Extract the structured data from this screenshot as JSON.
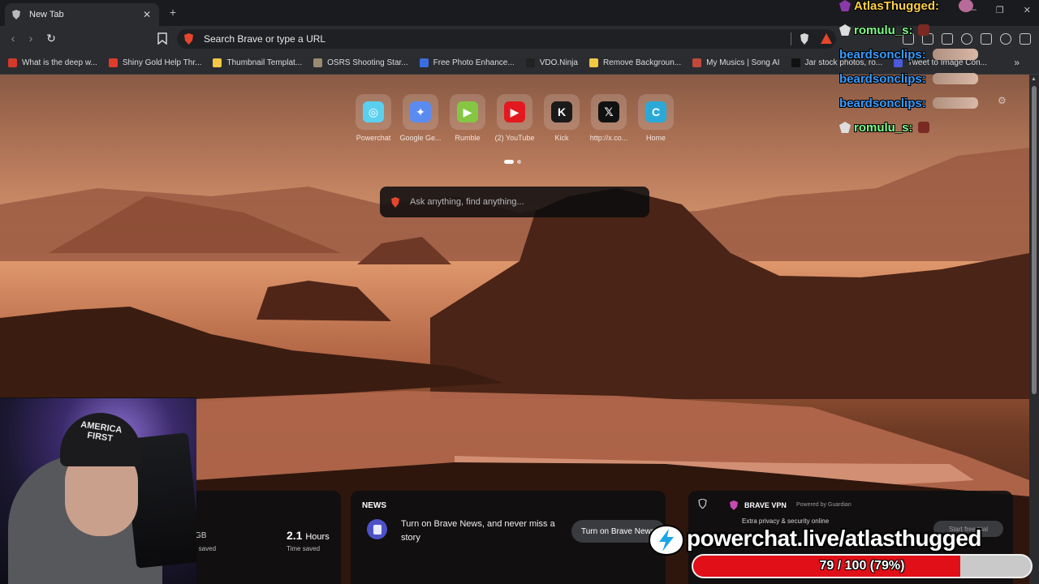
{
  "tab": {
    "title": "New Tab",
    "close": "✕",
    "new_tab": "+"
  },
  "window": {
    "minimize": "—",
    "maximize": "❐",
    "close": "✕"
  },
  "toolbar": {
    "back": "‹",
    "forward": "›",
    "reload": "↻",
    "omnibox_placeholder": "Search Brave or type a URL"
  },
  "bookmarks": [
    {
      "label": "What is the deep w...",
      "color": "#d23a2a"
    },
    {
      "label": "Shiny Gold Help Thr...",
      "color": "#e03c2c"
    },
    {
      "label": "Thumbnail Templat...",
      "color": "#f2c744"
    },
    {
      "label": "OSRS Shooting Star...",
      "color": "#9a8a70"
    },
    {
      "label": "Free Photo Enhance...",
      "color": "#3a6ee0"
    },
    {
      "label": "VDO.Ninja",
      "color": "#222222"
    },
    {
      "label": "Remove Backgroun...",
      "color": "#f2c744"
    },
    {
      "label": "My Musics | Song AI",
      "color": "#c04a3a"
    },
    {
      "label": "Jar stock photos, ro...",
      "color": "#111111"
    },
    {
      "label": "Tweet to Image Con...",
      "color": "#4a5ad8"
    }
  ],
  "bookmarks_more": "»",
  "top_sites": [
    {
      "label": "Powerchat",
      "icon": "powerchat-icon",
      "glyph": "◎",
      "bg": "#5ad0f0"
    },
    {
      "label": "Google Ge...",
      "icon": "gemini-icon",
      "glyph": "✦",
      "bg": "#5a8cf0"
    },
    {
      "label": "Rumble",
      "icon": "rumble-icon",
      "glyph": "▶",
      "bg": "#85c742"
    },
    {
      "label": "(2) YouTube",
      "icon": "youtube-icon",
      "glyph": "▶",
      "bg": "#e3191f"
    },
    {
      "label": "Kick",
      "icon": "kick-icon",
      "glyph": "K",
      "bg": "#1a1a1a"
    },
    {
      "label": "http://x.co...",
      "icon": "x-icon",
      "glyph": "𝕏",
      "bg": "#111111"
    },
    {
      "label": "Home",
      "icon": "canva-icon",
      "glyph": "C",
      "bg": "#2aa9d8"
    }
  ],
  "search": {
    "placeholder": "Ask anything, find anything..."
  },
  "chat": [
    {
      "nick": "AtlasThugged:",
      "color": "#ffd04a",
      "badge": "#8a3aa8",
      "extra": "tiny"
    },
    {
      "nick": "romulu_s:",
      "color": "#7dfc8a",
      "badge": "#dddddd",
      "extra": "small"
    },
    {
      "nick": "beardsonclips:",
      "color": "#3a9cff",
      "badge": "",
      "extra": "emote"
    },
    {
      "nick": "beardsonclips:",
      "color": "#3a9cff",
      "badge": "",
      "extra": "emote"
    },
    {
      "nick": "beardsonclips:",
      "color": "#3a9cff",
      "badge": "",
      "extra": "emote"
    },
    {
      "nick": "romulu_s:",
      "color": "#7dfc8a",
      "badge": "#dddddd",
      "extra": "small"
    }
  ],
  "stats": {
    "data_value": "GB",
    "data_label": "h saved",
    "time_value": "2.1",
    "time_unit": "Hours",
    "time_label": "Time saved"
  },
  "news": {
    "header": "NEWS",
    "text": "Turn on Brave News, and never miss a story",
    "button": "Turn on Brave News"
  },
  "vpn": {
    "title": "BRAVE VPN",
    "powered": "Powered by Guardian",
    "feature": "Extra privacy & security online",
    "trial": "Start free trial"
  },
  "webcam": {
    "cap_text": "AMERICA FIRST"
  },
  "powerchat": {
    "url": "powerchat.live/atlasthugged",
    "goal_text": "79 / 100 (79%)",
    "goal_fraction": 0.79,
    "fill_color": "#e10f17"
  }
}
